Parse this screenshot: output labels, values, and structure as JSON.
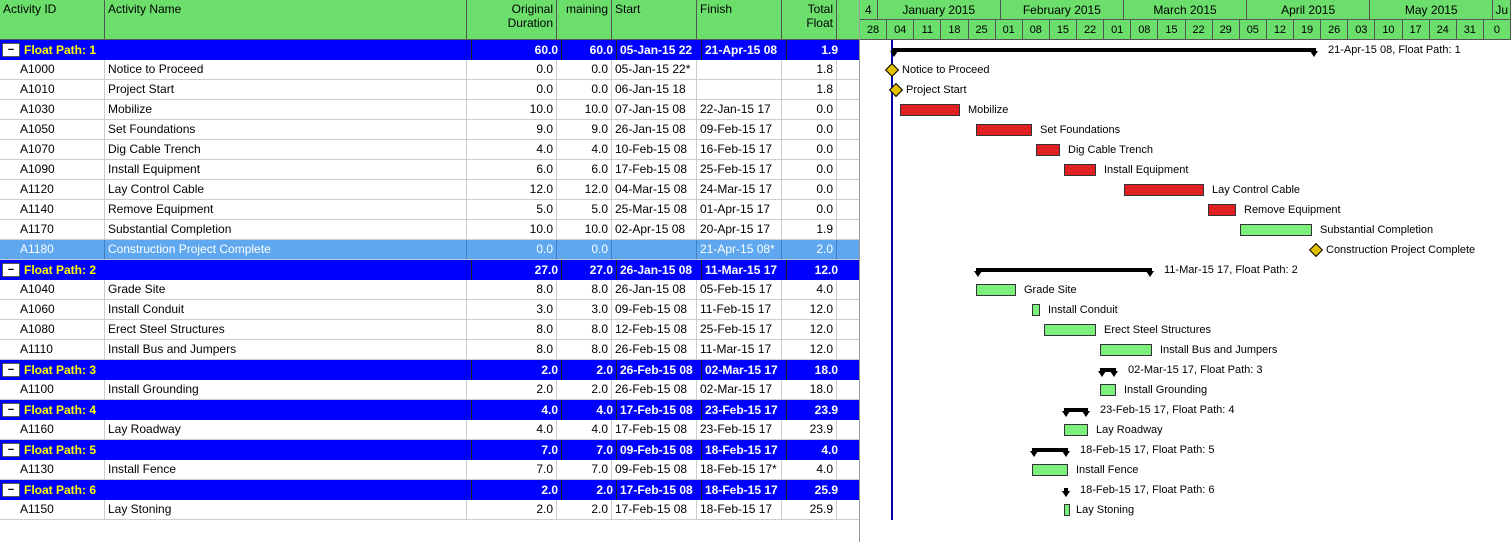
{
  "columns": {
    "id": "Activity ID",
    "name": "Activity Name",
    "origdur": "Original Duration",
    "remain": "maining",
    "start": "Start",
    "finish": "Finish",
    "float": "Total Float"
  },
  "months": [
    "4",
    "January 2015",
    "February 2015",
    "March 2015",
    "April 2015",
    "May 2015",
    "Ju"
  ],
  "days": [
    "28",
    "04",
    "11",
    "18",
    "25",
    "01",
    "08",
    "15",
    "22",
    "01",
    "08",
    "15",
    "22",
    "29",
    "05",
    "12",
    "19",
    "26",
    "03",
    "10",
    "17",
    "24",
    "31",
    "0"
  ],
  "groups": [
    {
      "name": "Float Path: 1",
      "od": "60.0",
      "rem": "60.0",
      "start": "05-Jan-15 22",
      "finish": "21-Apr-15 08",
      "float": "1.9",
      "acts": [
        {
          "id": "A1000",
          "name": "Notice to Proceed",
          "od": "0.0",
          "rem": "0.0",
          "start": "05-Jan-15 22*",
          "finish": "",
          "float": "1.8"
        },
        {
          "id": "A1010",
          "name": "Project Start",
          "od": "0.0",
          "rem": "0.0",
          "start": "06-Jan-15 18",
          "finish": "",
          "float": "1.8"
        },
        {
          "id": "A1030",
          "name": "Mobilize",
          "od": "10.0",
          "rem": "10.0",
          "start": "07-Jan-15 08",
          "finish": "22-Jan-15 17",
          "float": "0.0"
        },
        {
          "id": "A1050",
          "name": "Set Foundations",
          "od": "9.0",
          "rem": "9.0",
          "start": "26-Jan-15 08",
          "finish": "09-Feb-15 17",
          "float": "0.0"
        },
        {
          "id": "A1070",
          "name": "Dig Cable Trench",
          "od": "4.0",
          "rem": "4.0",
          "start": "10-Feb-15 08",
          "finish": "16-Feb-15 17",
          "float": "0.0"
        },
        {
          "id": "A1090",
          "name": "Install Equipment",
          "od": "6.0",
          "rem": "6.0",
          "start": "17-Feb-15 08",
          "finish": "25-Feb-15 17",
          "float": "0.0"
        },
        {
          "id": "A1120",
          "name": "Lay Control Cable",
          "od": "12.0",
          "rem": "12.0",
          "start": "04-Mar-15 08",
          "finish": "24-Mar-15 17",
          "float": "0.0"
        },
        {
          "id": "A1140",
          "name": "Remove Equipment",
          "od": "5.0",
          "rem": "5.0",
          "start": "25-Mar-15 08",
          "finish": "01-Apr-15 17",
          "float": "0.0"
        },
        {
          "id": "A1170",
          "name": "Substantial Completion",
          "od": "10.0",
          "rem": "10.0",
          "start": "02-Apr-15 08",
          "finish": "20-Apr-15 17",
          "float": "1.9"
        },
        {
          "id": "A1180",
          "name": "Construction Project Complete",
          "od": "0.0",
          "rem": "0.0",
          "start": "",
          "finish": "21-Apr-15 08*",
          "float": "2.0",
          "sel": true
        }
      ]
    },
    {
      "name": "Float Path: 2",
      "od": "27.0",
      "rem": "27.0",
      "start": "26-Jan-15 08",
      "finish": "11-Mar-15 17",
      "float": "12.0",
      "acts": [
        {
          "id": "A1040",
          "name": "Grade Site",
          "od": "8.0",
          "rem": "8.0",
          "start": "26-Jan-15 08",
          "finish": "05-Feb-15 17",
          "float": "4.0"
        },
        {
          "id": "A1060",
          "name": "Install Conduit",
          "od": "3.0",
          "rem": "3.0",
          "start": "09-Feb-15 08",
          "finish": "11-Feb-15 17",
          "float": "12.0"
        },
        {
          "id": "A1080",
          "name": "Erect Steel Structures",
          "od": "8.0",
          "rem": "8.0",
          "start": "12-Feb-15 08",
          "finish": "25-Feb-15 17",
          "float": "12.0"
        },
        {
          "id": "A1110",
          "name": "Install Bus and Jumpers",
          "od": "8.0",
          "rem": "8.0",
          "start": "26-Feb-15 08",
          "finish": "11-Mar-15 17",
          "float": "12.0"
        }
      ]
    },
    {
      "name": "Float Path: 3",
      "od": "2.0",
      "rem": "2.0",
      "start": "26-Feb-15 08",
      "finish": "02-Mar-15 17",
      "float": "18.0",
      "acts": [
        {
          "id": "A1100",
          "name": "Install Grounding",
          "od": "2.0",
          "rem": "2.0",
          "start": "26-Feb-15 08",
          "finish": "02-Mar-15 17",
          "float": "18.0"
        }
      ]
    },
    {
      "name": "Float Path: 4",
      "od": "4.0",
      "rem": "4.0",
      "start": "17-Feb-15 08",
      "finish": "23-Feb-15 17",
      "float": "23.9",
      "acts": [
        {
          "id": "A1160",
          "name": "Lay Roadway",
          "od": "4.0",
          "rem": "4.0",
          "start": "17-Feb-15 08",
          "finish": "23-Feb-15 17",
          "float": "23.9"
        }
      ]
    },
    {
      "name": "Float Path: 5",
      "od": "7.0",
      "rem": "7.0",
      "start": "09-Feb-15 08",
      "finish": "18-Feb-15 17",
      "float": "4.0",
      "acts": [
        {
          "id": "A1130",
          "name": "Install Fence",
          "od": "7.0",
          "rem": "7.0",
          "start": "09-Feb-15 08",
          "finish": "18-Feb-15 17*",
          "float": "4.0"
        }
      ]
    },
    {
      "name": "Float Path: 6",
      "od": "2.0",
      "rem": "2.0",
      "start": "17-Feb-15 08",
      "finish": "18-Feb-15 17",
      "float": "25.9",
      "acts": [
        {
          "id": "A1150",
          "name": "Lay Stoning",
          "od": "2.0",
          "rem": "2.0",
          "start": "17-Feb-15 08",
          "finish": "18-Feb-15 17",
          "float": "25.9"
        }
      ]
    }
  ],
  "gantt_labels": {
    "fp1": "21-Apr-15 08, Float Path: 1",
    "fp2": "11-Mar-15 17, Float Path: 2",
    "fp3": "02-Mar-15 17, Float Path: 3",
    "fp4": "23-Feb-15 17, Float Path: 4",
    "fp5": "18-Feb-15 17, Float Path: 5",
    "fp6": "18-Feb-15 17, Float Path: 6"
  }
}
